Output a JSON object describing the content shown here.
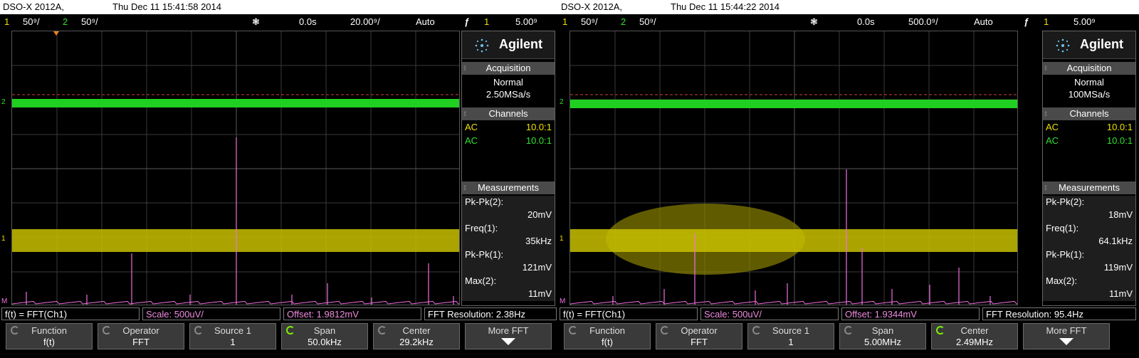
{
  "scopes": [
    {
      "title": {
        "model": "DSO-X 2012A,",
        "datetime": "Thu Dec 11 15:41:58 2014"
      },
      "status": {
        "ch1_num": "1",
        "ch1_scale": "50⁹/",
        "ch2_num": "2",
        "ch2_scale": "50⁹/",
        "acq_icon": "❃",
        "delay": "0.0s",
        "timebase": "20.00⁹/",
        "trigger_mode": "Auto",
        "trigger_icon": "ƒ",
        "trigger_ch": "1",
        "trigger_level": "5.00⁹"
      },
      "panel": {
        "brand": "Agilent",
        "acq_head": "Acquisition",
        "acq_mode": "Normal",
        "acq_rate": "2.50MSa/s",
        "ch_head": "Channels",
        "ch1_coupling": "AC",
        "ch1_probe": "10.0:1",
        "ch2_coupling": "AC",
        "ch2_probe": "10.0:1",
        "meas_head": "Measurements",
        "m1_name": "Pk-Pk(2):",
        "m1_value": "20mV",
        "m2_name": "Freq(1):",
        "m2_value": "35kHz",
        "m3_name": "Pk-Pk(1):",
        "m3_value": "121mV",
        "m4_name": "Max(2):",
        "m4_value": "11mV"
      },
      "fft_bar": {
        "func": "f(t) = FFT(Ch1)",
        "scale": "Scale: 500uV/",
        "offset": "Offset: 1.9812mV",
        "resolution": "FFT Resolution: 2.38Hz"
      },
      "softkeys": {
        "k1_label": "Function",
        "k1_value": "f(t)",
        "k2_label": "Operator",
        "k2_value": "FFT",
        "k3_label": "Source 1",
        "k3_value": "1",
        "k4_label": "Span",
        "k4_value": "50.0kHz",
        "k5_label": "Center",
        "k5_value": "29.2kHz",
        "k6_label": "More FFT"
      },
      "markers": {
        "ch2": "2",
        "ch1": "1",
        "math": "M"
      }
    },
    {
      "title": {
        "model": "DSO-X 2012A,",
        "datetime": "Thu Dec 11 15:44:22 2014"
      },
      "status": {
        "ch1_num": "1",
        "ch1_scale": "50⁹/",
        "ch2_num": "2",
        "ch2_scale": "50⁹/",
        "acq_icon": "❃",
        "delay": "0.0s",
        "timebase": "500.0⁹/",
        "trigger_mode": "Auto",
        "trigger_icon": "ƒ",
        "trigger_ch": "1",
        "trigger_level": "5.00⁹"
      },
      "panel": {
        "brand": "Agilent",
        "acq_head": "Acquisition",
        "acq_mode": "Normal",
        "acq_rate": "100MSa/s",
        "ch_head": "Channels",
        "ch1_coupling": "AC",
        "ch1_probe": "10.0:1",
        "ch2_coupling": "AC",
        "ch2_probe": "10.0:1",
        "meas_head": "Measurements",
        "m1_name": "Pk-Pk(2):",
        "m1_value": "18mV",
        "m2_name": "Freq(1):",
        "m2_value": "64.1kHz",
        "m3_name": "Pk-Pk(1):",
        "m3_value": "119mV",
        "m4_name": "Max(2):",
        "m4_value": "11mV"
      },
      "fft_bar": {
        "func": "f(t) = FFT(Ch1)",
        "scale": "Scale: 500uV/",
        "offset": "Offset: 1.9344mV",
        "resolution": "FFT Resolution: 95.4Hz"
      },
      "softkeys": {
        "k1_label": "Function",
        "k1_value": "f(t)",
        "k2_label": "Operator",
        "k2_value": "FFT",
        "k3_label": "Source 1",
        "k3_value": "1",
        "k4_label": "Span",
        "k4_value": "5.00MHz",
        "k5_label": "Center",
        "k5_value": "2.49MHz",
        "k6_label": "More FFT"
      },
      "markers": {
        "ch2": "2",
        "ch1": "1",
        "math": "M"
      }
    }
  ],
  "colors": {
    "ch1_trace": "#e8e000",
    "ch2_trace": "#20d020",
    "math_trace": "#f070e0",
    "grid": "#3a3a3a",
    "ref_line": "#d04040"
  }
}
